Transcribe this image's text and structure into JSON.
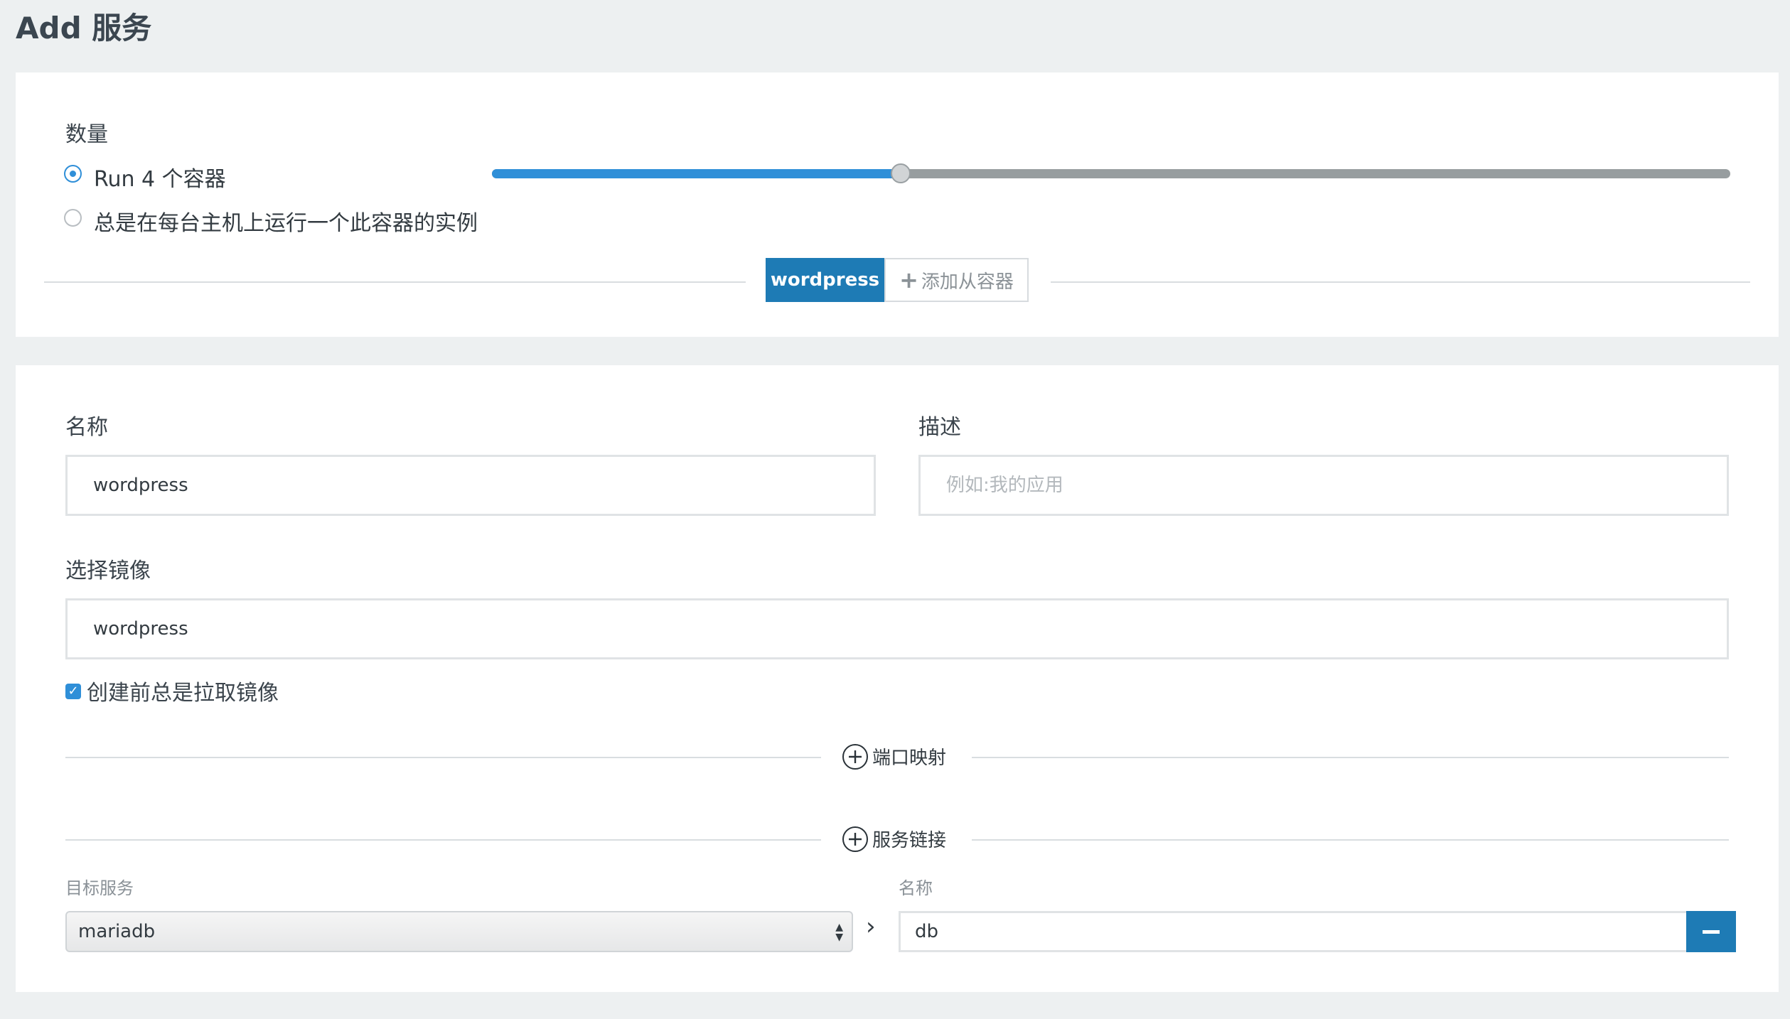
{
  "page": {
    "title": "Add 服务"
  },
  "scale": {
    "label": "数量",
    "run_option": "Run 4 个容器",
    "global_option": "总是在每台主机上运行一个此容器的实例",
    "selected_option": "run",
    "slider_fraction": 0.33
  },
  "container_tabs": {
    "active": "wordpress",
    "add_label": "添加从容器"
  },
  "form": {
    "name_label": "名称",
    "name_value": "wordpress",
    "description_label": "描述",
    "description_placeholder": "例如:我的应用",
    "image_label": "选择镜像",
    "image_value": "wordpress",
    "pull_label": "创建前总是拉取镜像",
    "pull_checked": true
  },
  "sections": {
    "port_mapping": "端口映射",
    "service_links": "服务链接"
  },
  "links": {
    "target_label": "目标服务",
    "alias_label": "名称",
    "target_value": "mariadb",
    "alias_value": "db"
  },
  "colors": {
    "accent": "#1e7bb5",
    "slider_fill": "#2f8fd8",
    "background": "#edf0f1"
  }
}
